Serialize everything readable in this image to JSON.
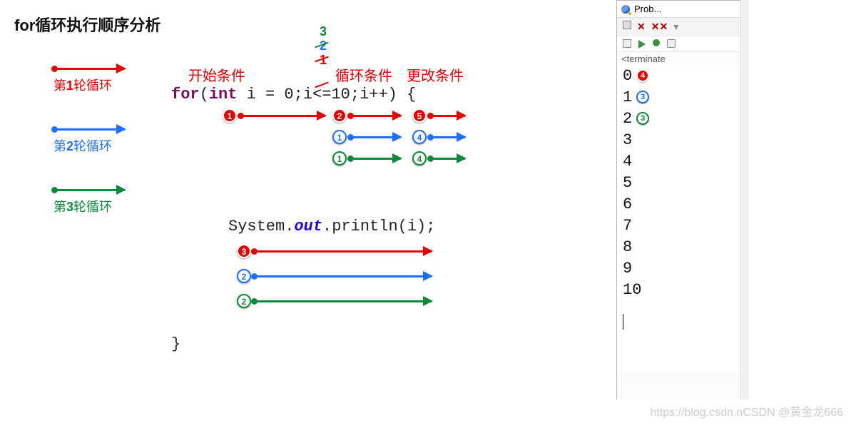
{
  "title": "for循环执行顺序分析",
  "legend": {
    "items": [
      {
        "prefix": "第",
        "num": "1",
        "suffix": "轮循环",
        "color": "red"
      },
      {
        "prefix": "第",
        "num": "2",
        "suffix": "轮循环",
        "color": "blue"
      },
      {
        "prefix": "第",
        "num": "3",
        "suffix": "轮循环",
        "color": "green"
      }
    ]
  },
  "annotations": {
    "start_cond": "开始条件",
    "loop_cond": "循环条件",
    "update_cond": "更改条件",
    "top_passes": {
      "green": "3",
      "blue": "2",
      "red": "1"
    }
  },
  "code": {
    "line1": {
      "for": "for",
      "open": "(",
      "int": "int",
      "decl": " i = 0;",
      "cond": "i<=10;",
      "upd": "i++) {"
    },
    "line2": {
      "sys": "System.",
      "out": "out",
      "call": ".println(i);"
    },
    "line3": "}"
  },
  "flow_badges": {
    "row_red": [
      {
        "n": "1"
      },
      {
        "n": "2"
      },
      {
        "n": "5"
      }
    ],
    "row_blue": [
      {
        "n": "1"
      },
      {
        "n": "4"
      }
    ],
    "row_green": [
      {
        "n": "1"
      },
      {
        "n": "4"
      }
    ],
    "print_red": "3",
    "print_blue": "2",
    "print_green": "2"
  },
  "console": {
    "tab_title": "Prob...",
    "status_line": "<terminate",
    "values": [
      "0",
      "1",
      "2",
      "3",
      "4",
      "5",
      "6",
      "7",
      "8",
      "9",
      "10"
    ],
    "value_badges": {
      "0": "4",
      "1": "3",
      "2": "3"
    }
  },
  "watermark": "https://blog.csdn.nCSDN @黄金龙666",
  "colors": {
    "red": "#e60000",
    "blue": "#1e6fff",
    "green": "#0b8a3a"
  }
}
